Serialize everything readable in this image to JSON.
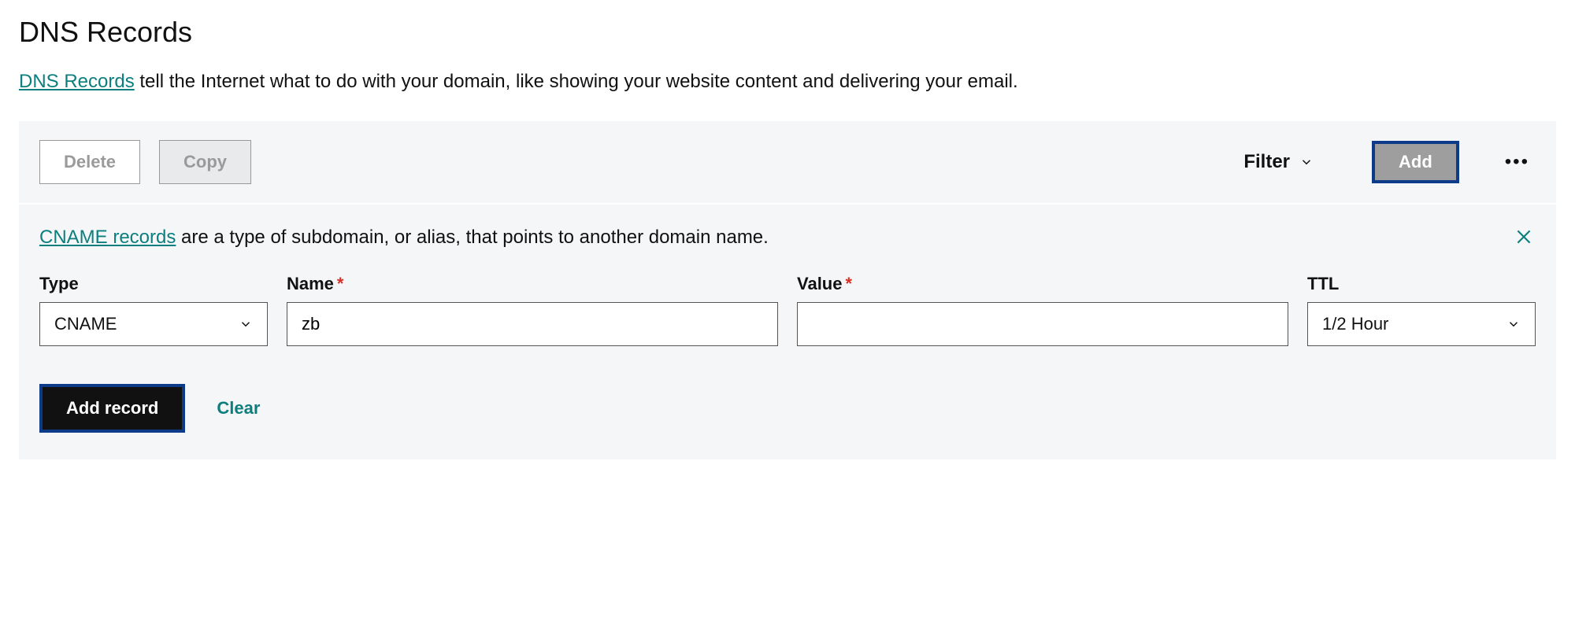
{
  "header": {
    "title": "DNS Records",
    "intro_link": "DNS Records",
    "intro_text": " tell the Internet what to do with your domain, like showing your website content and delivering your email."
  },
  "toolbar": {
    "delete_label": "Delete",
    "copy_label": "Copy",
    "filter_label": "Filter",
    "add_label": "Add",
    "more_label": "•••"
  },
  "form": {
    "desc_link": "CNAME records",
    "desc_text": " are a type of subdomain, or alias, that points to another domain name.",
    "labels": {
      "type": "Type",
      "name": "Name",
      "value": "Value",
      "ttl": "TTL"
    },
    "required_mark": "*",
    "values": {
      "type": "CNAME",
      "name": "zb",
      "value": "",
      "ttl": "1/2 Hour"
    },
    "actions": {
      "submit": "Add record",
      "clear": "Clear"
    }
  }
}
